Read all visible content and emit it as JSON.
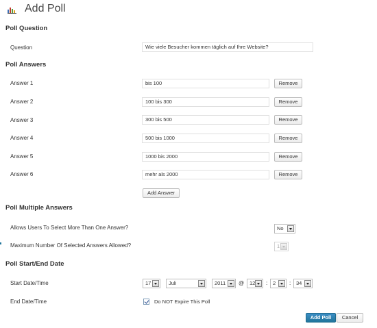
{
  "header": {
    "title": "Add Poll",
    "icon": "poll-chart-icon"
  },
  "question_section": {
    "heading": "Poll Question",
    "label": "Question",
    "value": "Wie viele Besucher kommen täglich auf Ihre Website?"
  },
  "answers_section": {
    "heading": "Poll Answers",
    "answers": [
      {
        "label": "Answer 1",
        "value": "bis 100",
        "remove": "Remove"
      },
      {
        "label": "Answer 2",
        "value": "100 bis 300",
        "remove": "Remove"
      },
      {
        "label": "Answer 3",
        "value": "300 bis 500",
        "remove": "Remove"
      },
      {
        "label": "Answer 4",
        "value": "500 bis 1000",
        "remove": "Remove"
      },
      {
        "label": "Answer 5",
        "value": "1000 bis 2000",
        "remove": "Remove"
      },
      {
        "label": "Answer 6",
        "value": "mehr als 2000",
        "remove": "Remove"
      }
    ],
    "add_label": "Add Answer"
  },
  "multiple_section": {
    "heading": "Poll Multiple Answers",
    "allow_label": "Allows Users To Select More Than One Answer?",
    "allow_value": "No",
    "max_label": "Maximum Number Of Selected Answers Allowed?",
    "max_value": "1"
  },
  "date_section": {
    "heading": "Poll Start/End Date",
    "start_label": "Start Date/Time",
    "day": "17",
    "month": "Juli",
    "year": "2011",
    "at": "@",
    "hour": "12",
    "minute": "2",
    "second": "34",
    "colon": ":",
    "end_label": "End Date/Time",
    "no_expire_label": "Do NOT Expire This Poll",
    "no_expire_checked": true
  },
  "footer": {
    "submit": "Add Poll",
    "cancel": "Cancel"
  },
  "colors": {
    "primary": "#21759b",
    "border": "#dfdfdf"
  }
}
